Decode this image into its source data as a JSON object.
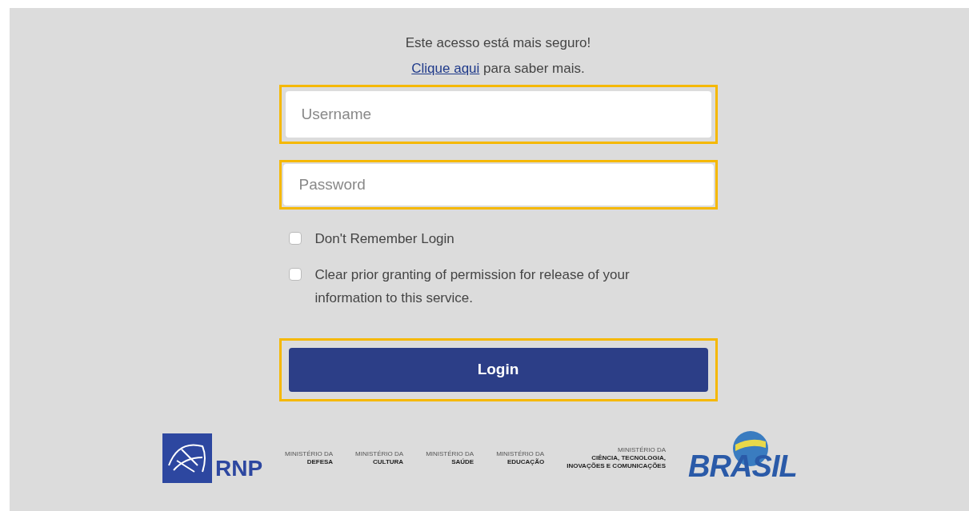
{
  "notice": {
    "headline": "Este acesso está mais seguro!",
    "link": "Clique aqui",
    "rest": "para saber mais."
  },
  "fields": [
    {
      "placeholder": "Username",
      "highlighted": true
    },
    {
      "placeholder": "Password",
      "highlighted": true
    }
  ],
  "options": [
    {
      "label": "Don't Remember Login",
      "checked": false
    },
    {
      "label": "Clear prior granting of permission for release of your information to this service.",
      "checked": false
    }
  ],
  "login_button": {
    "label": "Login",
    "highlighted": true
  },
  "logos": [
    {
      "kind": "rnp",
      "text": "RNP"
    },
    {
      "kind": "ministry",
      "lines": [
        "MINISTÉRIO DA",
        "DEFESA"
      ]
    },
    {
      "kind": "ministry",
      "lines": [
        "MINISTÉRIO DA",
        "CULTURA"
      ]
    },
    {
      "kind": "ministry",
      "lines": [
        "MINISTÉRIO DA",
        "SAÚDE"
      ]
    },
    {
      "kind": "ministry",
      "lines": [
        "MINISTÉRIO DA",
        "EDUCAÇÃO"
      ]
    },
    {
      "kind": "ministry",
      "lines": [
        "MINISTÉRIO DA",
        "CIÊNCIA, TECNOLOGIA,",
        "INOVAÇÕES E COMUNICAÇÕES"
      ]
    },
    {
      "kind": "brasil",
      "text": "BRASIL"
    }
  ]
}
